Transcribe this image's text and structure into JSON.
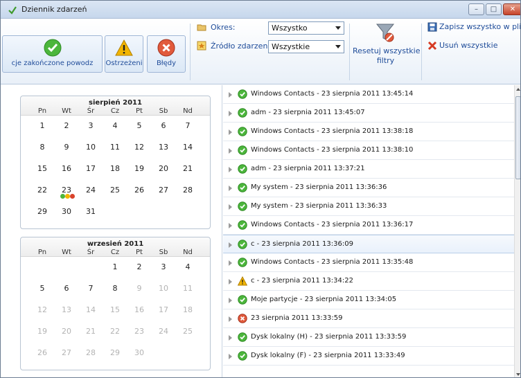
{
  "window": {
    "title": "Dziennik zdarzeń",
    "min_glyph": "–",
    "max_glyph": "□",
    "close_glyph": "✕"
  },
  "toolbar": {
    "filters": [
      {
        "label": "cje zakończone powodz",
        "icon": "success-icon"
      },
      {
        "label": "Ostrzeżeni",
        "icon": "warning-icon"
      },
      {
        "label": "Błędy",
        "icon": "error-icon"
      }
    ],
    "period_label": "Okres:",
    "period_value": "Wszystko",
    "source_label": "Źródło zdarzenia:",
    "source_value": "Wszystkie",
    "reset_label_line1": "Resetuj wszystkie",
    "reset_label_line2": "filtry",
    "save_all": "Zapisz wszystko w pliku",
    "delete_all": "Usuń wszystkie"
  },
  "calendars": [
    {
      "month": "sierpień 2011",
      "day_names": [
        "Pn",
        "Wt",
        "Śr",
        "Cz",
        "Pt",
        "Sb",
        "Nd"
      ],
      "weeks": [
        [
          "1",
          "2",
          "3",
          "4",
          "5",
          "6",
          "7"
        ],
        [
          "8",
          "9",
          "10",
          "11",
          "12",
          "13",
          "14"
        ],
        [
          "15",
          "16",
          "17",
          "18",
          "19",
          "20",
          "21"
        ],
        [
          "22",
          "23",
          "24",
          "25",
          "26",
          "27",
          "28"
        ],
        [
          "29",
          "30",
          "31",
          "",
          "",
          "",
          ""
        ]
      ],
      "marked_day": "23"
    },
    {
      "month": "wrzesień 2011",
      "day_names": [
        "Pn",
        "Wt",
        "Śr",
        "Cz",
        "Pt",
        "Sb",
        "Nd"
      ],
      "weeks": [
        [
          "",
          "",
          "",
          "1",
          "2",
          "3",
          "4"
        ],
        [
          "5",
          "6",
          "7",
          "8",
          "9",
          "10",
          "11"
        ],
        [
          "12",
          "13",
          "14",
          "15",
          "16",
          "17",
          "18"
        ],
        [
          "19",
          "20",
          "21",
          "22",
          "23",
          "24",
          "25"
        ],
        [
          "26",
          "27",
          "28",
          "29",
          "30",
          "",
          ""
        ]
      ],
      "active_until": "8"
    }
  ],
  "events": [
    {
      "text": "Windows Contacts - 23 sierpnia 2011 13:45:14",
      "status": "success"
    },
    {
      "text": "adm - 23 sierpnia 2011 13:45:07",
      "status": "success"
    },
    {
      "text": "Windows Contacts - 23 sierpnia 2011 13:38:18",
      "status": "success"
    },
    {
      "text": "Windows Contacts - 23 sierpnia 2011 13:38:10",
      "status": "success"
    },
    {
      "text": "adm - 23 sierpnia 2011 13:37:21",
      "status": "success"
    },
    {
      "text": "My system - 23 sierpnia 2011 13:36:36",
      "status": "success"
    },
    {
      "text": "My system - 23 sierpnia 2011 13:36:33",
      "status": "success"
    },
    {
      "text": "Windows Contacts - 23 sierpnia 2011 13:36:17",
      "status": "success"
    },
    {
      "text": "c - 23 sierpnia 2011 13:36:09",
      "status": "success",
      "selected": true
    },
    {
      "text": "Windows Contacts - 23 sierpnia 2011 13:35:48",
      "status": "success"
    },
    {
      "text": "c - 23 sierpnia 2011 13:34:22",
      "status": "warning"
    },
    {
      "text": "Moje partycje - 23 sierpnia 2011 13:34:05",
      "status": "success"
    },
    {
      "text": "23 sierpnia 2011 13:33:59",
      "status": "error"
    },
    {
      "text": "Dysk lokalny (H) - 23 sierpnia 2011 13:33:59",
      "status": "success"
    },
    {
      "text": "Dysk lokalny (F) - 23 sierpnia 2011 13:33:49",
      "status": "success"
    }
  ],
  "colors": {
    "success": "#4cb63c",
    "warning": "#f2b500",
    "error": "#d9432b",
    "link": "#1f4c99"
  }
}
